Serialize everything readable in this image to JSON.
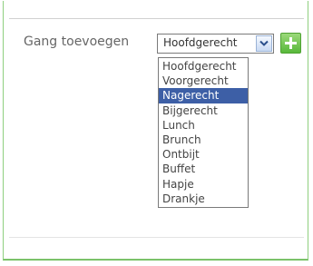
{
  "form": {
    "label": "Gang toevoegen",
    "selected_value": "Hoofdgerecht"
  },
  "dropdown": {
    "options": [
      "Hoofdgerecht",
      "Voorgerecht",
      "Nagerecht",
      "Bijgerecht",
      "Lunch",
      "Brunch",
      "Ontbijt",
      "Buffet",
      "Hapje",
      "Drankje"
    ],
    "highlighted_index": 2
  },
  "colors": {
    "panel_border": "#8fcf7f",
    "highlight": "#3d5fa6",
    "add_button": "#58b83a"
  },
  "icons": {
    "dropdown_toggle": "chevron-down-icon",
    "add": "plus-icon"
  }
}
